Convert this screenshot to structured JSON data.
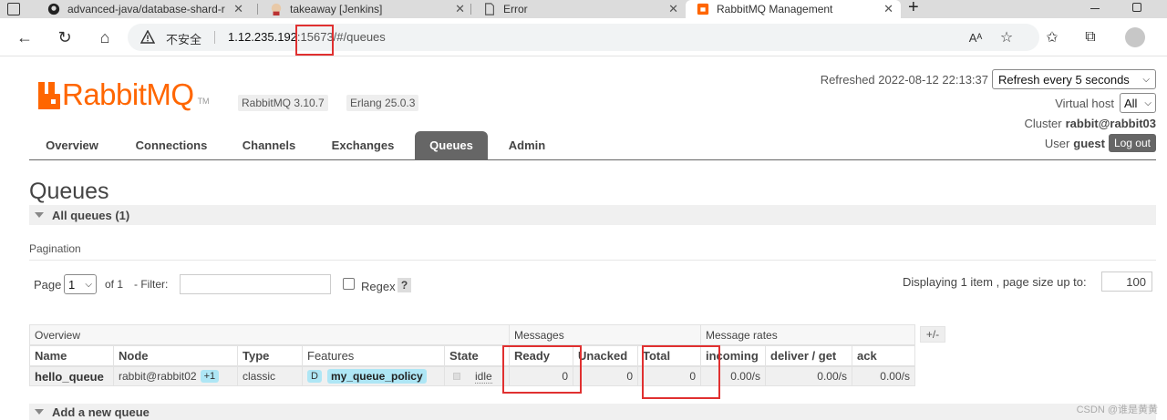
{
  "browser": {
    "tabs": [
      {
        "title": "advanced-java/database-shard-r",
        "icon": "github-icon"
      },
      {
        "title": "takeaway [Jenkins]",
        "icon": "jenkins-icon"
      },
      {
        "title": "Error",
        "icon": "document-icon"
      },
      {
        "title": "RabbitMQ Management",
        "icon": "rabbitmq-icon",
        "active": true
      }
    ],
    "new_tab": "+",
    "insecure_label": "不安全",
    "url": {
      "host": "1.12.235.192",
      "port": ":15673",
      "path": "/#/queues"
    }
  },
  "header": {
    "logo_text": "RabbitMQ",
    "logo_tm": "TM",
    "rabbitmq_version": "RabbitMQ 3.10.7",
    "erlang_version": "Erlang 25.0.3",
    "refreshed_label": "Refreshed 2022-08-12 22:13:37",
    "refresh_select": "Refresh every 5 seconds",
    "vhost_label": "Virtual host",
    "vhost_value": "All",
    "cluster_label": "Cluster",
    "cluster_value": "rabbit@rabbit03",
    "user_label": "User",
    "user_value": "guest",
    "logout": "Log out",
    "accent": "#ff6600"
  },
  "nav": {
    "tabs": [
      "Overview",
      "Connections",
      "Channels",
      "Exchanges",
      "Queues",
      "Admin"
    ],
    "active": "Queues"
  },
  "page": {
    "title": "Queues",
    "all_queues": "All queues (1)",
    "pagination_label": "Pagination",
    "page_label": "Page",
    "page_value": "1",
    "of_label": "of 1",
    "filter_label": "- Filter:",
    "regex_label": "Regex",
    "help": "?",
    "displaying": "Displaying 1 item , page size up to:",
    "page_size": "100",
    "add_queue": "Add a new queue"
  },
  "table": {
    "groups": [
      "Overview",
      "Messages",
      "Message rates"
    ],
    "plusminus": "+/-",
    "headers": [
      "Name",
      "Node",
      "Type",
      "Features",
      "State",
      "Ready",
      "Unacked",
      "Total",
      "incoming",
      "deliver / get",
      "ack"
    ],
    "rows": [
      {
        "name": "hello_queue",
        "node": "rabbit@rabbit02",
        "node_extra": "+1",
        "type": "classic",
        "feature_flag": "D",
        "policy": "my_queue_policy",
        "state": "idle",
        "ready": "0",
        "unacked": "0",
        "total": "0",
        "incoming": "0.00/s",
        "deliver_get": "0.00/s",
        "ack": "0.00/s"
      }
    ]
  },
  "watermark": "CSDN @谁是黄黄"
}
